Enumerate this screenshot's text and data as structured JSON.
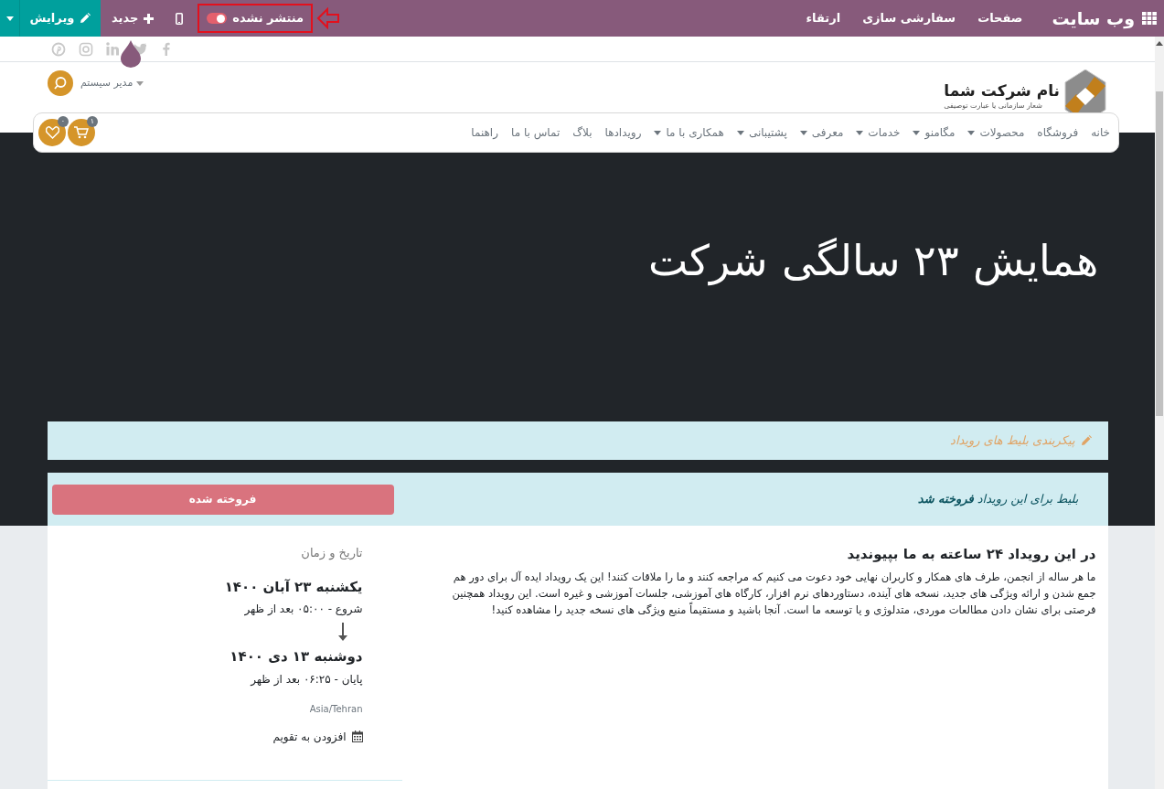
{
  "topbar": {
    "app_title": "وب سایت",
    "menu": [
      "صفحات",
      "سفارشی سازی",
      "ارتقاء"
    ],
    "publish": {
      "label": "منتشر نشده",
      "published": false
    },
    "new_label": "جدید",
    "edit_label": "ویرایش"
  },
  "header": {
    "company_name": "نام شرکت شما",
    "tagline": "شعار سازمانی یا عبارت توصیفی",
    "user": "مدیر سیستم",
    "cart_count": "۱",
    "wishlist_count": "۰"
  },
  "nav": [
    {
      "label": "خانه",
      "dropdown": false
    },
    {
      "label": "فروشگاه",
      "dropdown": false
    },
    {
      "label": "محصولات",
      "dropdown": true
    },
    {
      "label": "مگامنو",
      "dropdown": true
    },
    {
      "label": "خدمات",
      "dropdown": true
    },
    {
      "label": "معرفی",
      "dropdown": true
    },
    {
      "label": "پشتیبانی",
      "dropdown": true
    },
    {
      "label": "همکاری با ما",
      "dropdown": true
    },
    {
      "label": "رویدادها",
      "dropdown": false
    },
    {
      "label": "بلاگ",
      "dropdown": false
    },
    {
      "label": "تماس با ما",
      "dropdown": false
    },
    {
      "label": "راهنما",
      "dropdown": false
    }
  ],
  "hero": {
    "title": "همایش ۲۳ سالگی شرکت"
  },
  "ticket_config": "پیکربندی بلیط های رویداد",
  "sold_out": {
    "message": "بلیط برای این رویداد **فروخته شد**",
    "button": "فروخته شده"
  },
  "about": {
    "heading": "در این رویداد ۲۴ ساعته به ما بپیوندید",
    "text": "ما هر ساله از انجمن، طرف های همکار و کاربران نهایی خود دعوت می کنیم که مراجعه کنند و ما را ملاقات کنند! این یک رویداد ایده آل برای دور هم جمع شدن و ارائه ویژگی های جدید، نسخه های آینده، دستاوردهای نرم افزار، کارگاه های آموزشی، جلسات آموزشی و غیره است. این رویداد همچنین فرصتی برای نشان دادن مطالعات موردی، متدلوژی و یا توسعه ما است. آنجا باشید و مستقیماً منبع ویژگی های نسخه جدید را مشاهده کنید!"
  },
  "schedule": {
    "label": "تاریخ و زمان",
    "start_date": "یکشنبه ۲۳ آبان ۱۴۰۰",
    "start_time": "شروع - ۰۵:۰۰ بعد از ظهر",
    "end_date": "دوشنبه ۱۳ دی ۱۴۰۰",
    "end_time": "پایان - ۰۶:۲۵ بعد از ظهر",
    "timezone": "Asia/Tehran",
    "add_calendar": "افزودن به تقویم"
  }
}
